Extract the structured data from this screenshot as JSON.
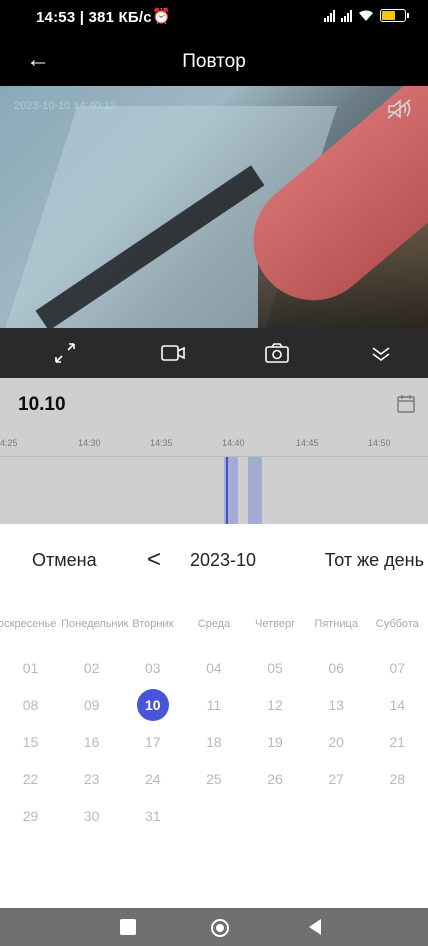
{
  "status_bar": {
    "time_speed": "14:53 | 381 КБ/с",
    "alarm_icon": "alarm-icon",
    "battery_icon": "battery-icon"
  },
  "header": {
    "title": "Повтор",
    "back_icon": "arrow-left-icon"
  },
  "video": {
    "osd": "2023-10-10 14:40:12",
    "mute_icon": "speaker-muted-icon"
  },
  "controls": {
    "icons": [
      "fullscreen-icon",
      "record-video-icon",
      "snapshot-camera-icon",
      "collapse-chevrons-icon"
    ]
  },
  "playback": {
    "date": "10.10",
    "ticks": [
      "4:25",
      "14:30",
      "14:35",
      "14:40",
      "14:45",
      "14:50"
    ]
  },
  "date_picker": {
    "cancel": "Отмена",
    "prev": "<",
    "month": "2023-10",
    "same_day": "Тот же день",
    "weekdays": [
      "Воскресенье",
      "Понедельник",
      "Вторник",
      "Среда",
      "Четверг",
      "Пятница",
      "Суббота"
    ],
    "weeks": [
      [
        "01",
        "02",
        "03",
        "04",
        "05",
        "06",
        "07"
      ],
      [
        "08",
        "09",
        "10",
        "11",
        "12",
        "13",
        "14"
      ],
      [
        "15",
        "16",
        "17",
        "18",
        "19",
        "20",
        "21"
      ],
      [
        "22",
        "23",
        "24",
        "25",
        "26",
        "27",
        "28"
      ],
      [
        "29",
        "30",
        "31",
        "",
        "",
        "",
        ""
      ]
    ],
    "selected_day": "10"
  },
  "colors": {
    "accent": "#4756d9",
    "timeline_recording": "#9ba6d2"
  }
}
